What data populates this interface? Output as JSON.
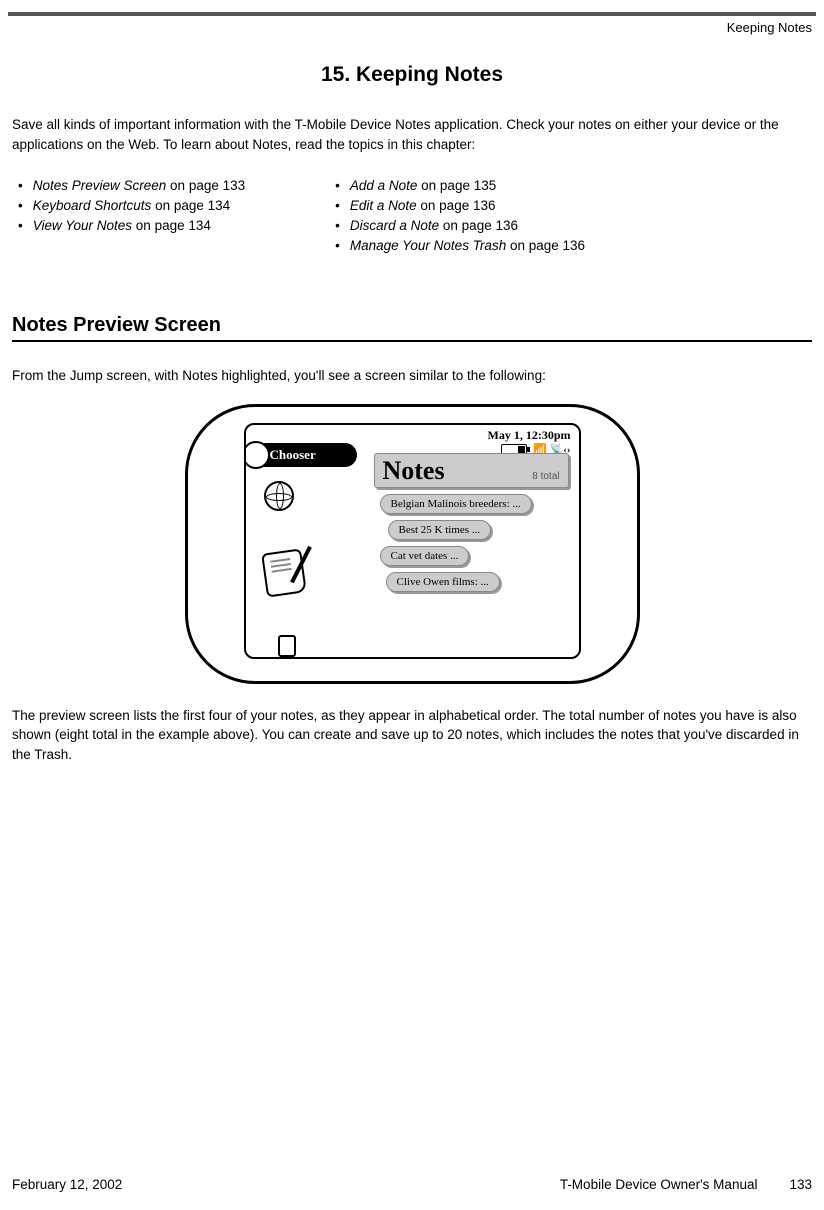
{
  "header": {
    "running_head": "Keeping Notes"
  },
  "chapter": {
    "number_title": "15.  Keeping Notes",
    "intro": "Save all kinds of important information with the T-Mobile Device Notes application. Check your notes on either your device or the applications on the Web. To learn about Notes, read the topics in this chapter:"
  },
  "toc": {
    "left": [
      {
        "title": "Notes Preview Screen",
        "suffix": " on page 133"
      },
      {
        "title": "Keyboard Shortcuts",
        "suffix": " on page 134"
      },
      {
        "title": "View Your Notes",
        "suffix": " on page 134"
      }
    ],
    "right": [
      {
        "title": "Add a Note",
        "suffix": " on page 135"
      },
      {
        "title": "Edit a Note",
        "suffix": " on page 136"
      },
      {
        "title": "Discard a Note",
        "suffix": " on page 136"
      },
      {
        "title": "Manage Your Notes Trash",
        "suffix": " on page 136"
      }
    ]
  },
  "section": {
    "heading": "Notes Preview Screen",
    "lead": "From the Jump screen, with Notes highlighted, you'll see a screen similar to the following:",
    "caption": "The preview screen lists the first four of your notes, as they appear in alphabetical order. The total number of notes you have is also shown (eight total in the example above). You can create and save up to 20 notes, which includes the notes that you've discarded in the Trash."
  },
  "device_screenshot": {
    "status": {
      "datetime": "May 1, 12:30pm",
      "signal": "📶 📡‹›"
    },
    "chooser_label": "Chooser",
    "notes_header": {
      "title": "Notes",
      "count": "8 total"
    },
    "notes": [
      "Belgian Malinois breeders: ...",
      "Best 25 K times ...",
      "Cat vet dates ...",
      "Clive Owen films: ..."
    ]
  },
  "footer": {
    "date": "February 12, 2002",
    "manual": "T-Mobile Device Owner's Manual",
    "page": "133"
  }
}
